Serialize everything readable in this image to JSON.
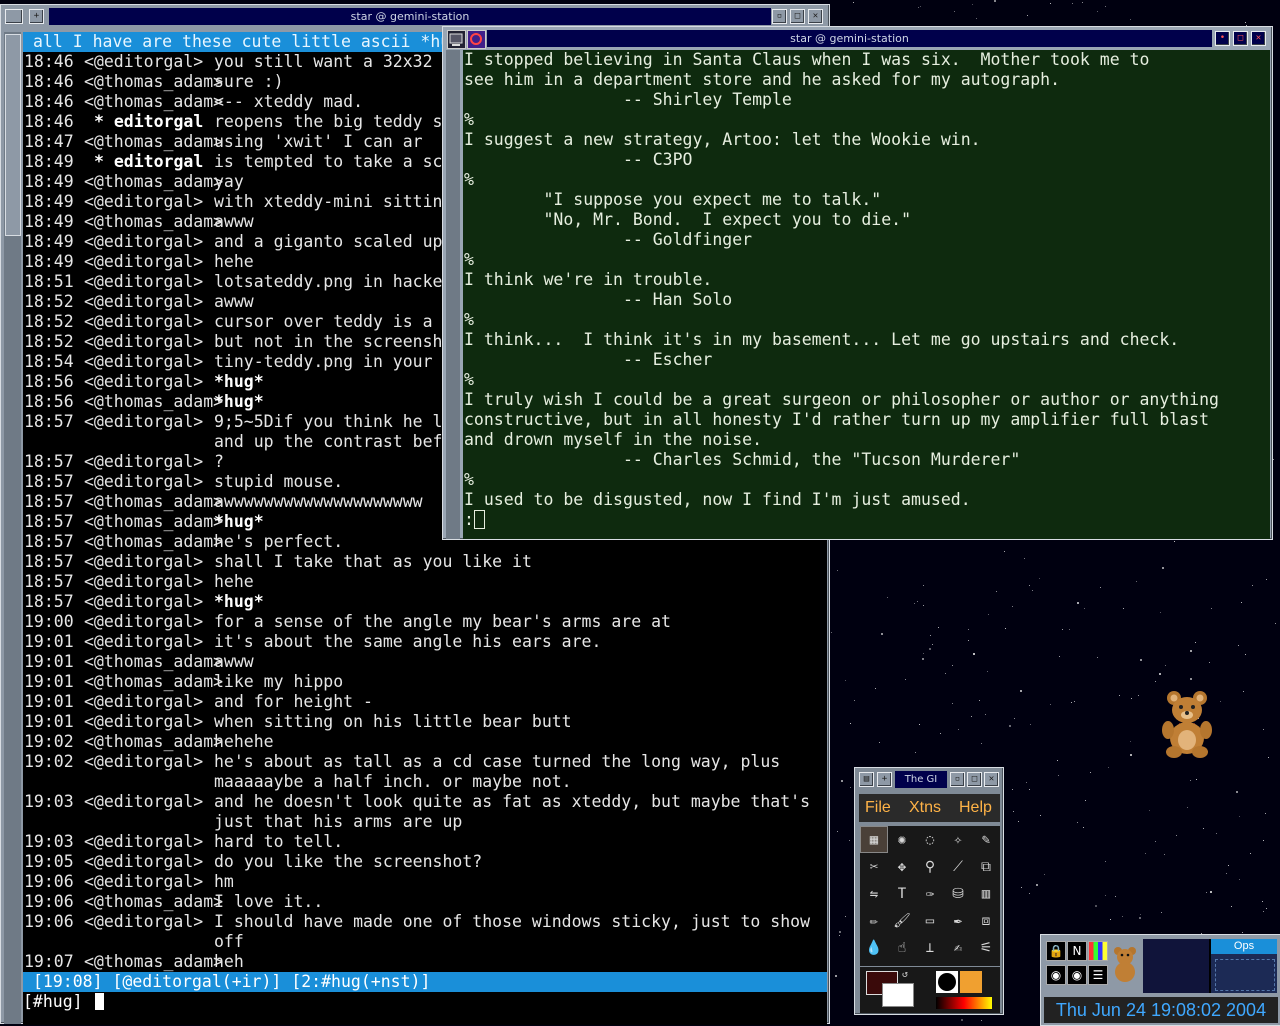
{
  "irc_window": {
    "title": "star @ gemini-station",
    "topic": "all I have are these cute little ascii *hugs*",
    "lines": [
      {
        "ts": "18:46",
        "nick": "<@editorgal>",
        "msg": "you still want a 32x32"
      },
      {
        "ts": "18:46",
        "nick": "<@thomas_adam>",
        "msg": "sure :)"
      },
      {
        "ts": "18:46",
        "nick": "<@thomas_adam>",
        "msg": "<-- xteddy mad."
      },
      {
        "ts": "18:46",
        "action": "* editorgal",
        "msg": "reopens the big teddy s"
      },
      {
        "ts": "18:47",
        "nick": "<@thomas_adam>",
        "msg": "using 'xwit' I can ar"
      },
      {
        "ts": "18:49",
        "action": "* editorgal",
        "msg": "is tempted to take a sc"
      },
      {
        "ts": "18:49",
        "nick": "<@thomas_adam>",
        "msg": "yay"
      },
      {
        "ts": "18:49",
        "nick": "<@editorgal>",
        "msg": "with xteddy-mini sittin"
      },
      {
        "ts": "18:49",
        "nick": "<@thomas_adam>",
        "msg": "awww"
      },
      {
        "ts": "18:49",
        "nick": "<@editorgal>",
        "msg": "and a giganto scaled up"
      },
      {
        "ts": "18:49",
        "nick": "<@editorgal>",
        "msg": "hehe"
      },
      {
        "ts": "18:51",
        "nick": "<@editorgal>",
        "msg": "lotsateddy.png in hacke"
      },
      {
        "ts": "18:52",
        "nick": "<@editorgal>",
        "msg": "awww"
      },
      {
        "ts": "18:52",
        "nick": "<@editorgal>",
        "msg": "cursor over teddy is a"
      },
      {
        "ts": "18:52",
        "nick": "<@editorgal>",
        "msg": "but not in the screensh"
      },
      {
        "ts": "18:54",
        "nick": "<@editorgal>",
        "msg": "tiny-teddy.png in your"
      },
      {
        "ts": "18:56",
        "nick": "<@editorgal>",
        "msg": "*hug*",
        "bold": true
      },
      {
        "ts": "18:56",
        "nick": "<@thomas_adam>",
        "msg": "*hug*",
        "bold": true
      },
      {
        "ts": "18:57",
        "nick": "<@editorgal>",
        "msg": "9;5~5Dif you think he l",
        "cont": "and up the contrast bef"
      },
      {
        "ts": "18:57",
        "nick": "<@editorgal>",
        "msg": "?"
      },
      {
        "ts": "18:57",
        "nick": "<@editorgal>",
        "msg": "stupid mouse."
      },
      {
        "ts": "18:57",
        "nick": "<@thomas_adam>",
        "msg": "awwwwwwwwwwwwwwwwwwww"
      },
      {
        "ts": "18:57",
        "nick": "<@thomas_adam>",
        "msg": "*hug*",
        "bold": true
      },
      {
        "ts": "18:57",
        "nick": "<@thomas_adam>",
        "msg": "he's perfect."
      },
      {
        "ts": "18:57",
        "nick": "<@editorgal>",
        "msg": "shall I take that as you like it"
      },
      {
        "ts": "18:57",
        "nick": "<@editorgal>",
        "msg": "hehe"
      },
      {
        "ts": "18:57",
        "nick": "<@editorgal>",
        "msg": "*hug*",
        "bold": true
      },
      {
        "ts": "19:00",
        "nick": "<@editorgal>",
        "msg": "for a sense of the angle my bear's arms are at"
      },
      {
        "ts": "19:01",
        "nick": "<@editorgal>",
        "msg": "it's about the same angle his ears are."
      },
      {
        "ts": "19:01",
        "nick": "<@thomas_adam>",
        "msg": "awww"
      },
      {
        "ts": "19:01",
        "nick": "<@thomas_adam>",
        "msg": "like my hippo"
      },
      {
        "ts": "19:01",
        "nick": "<@editorgal>",
        "msg": "and for height -"
      },
      {
        "ts": "19:01",
        "nick": "<@editorgal>",
        "msg": "when sitting on his little bear butt"
      },
      {
        "ts": "19:02",
        "nick": "<@thomas_adam>",
        "msg": "hehehe"
      },
      {
        "ts": "19:02",
        "nick": "<@editorgal>",
        "msg": "he's about as tall as a cd case turned the long way, plus",
        "cont": "maaaaaybe a half inch. or maybe not."
      },
      {
        "ts": "19:03",
        "nick": "<@editorgal>",
        "msg": "and he doesn't look quite as fat as xteddy, but maybe that's",
        "cont": "just that his arms are up"
      },
      {
        "ts": "19:03",
        "nick": "<@editorgal>",
        "msg": "hard to tell."
      },
      {
        "ts": "19:05",
        "nick": "<@editorgal>",
        "msg": "do you like the screenshot?"
      },
      {
        "ts": "19:06",
        "nick": "<@editorgal>",
        "msg": "hm"
      },
      {
        "ts": "19:06",
        "nick": "<@thomas_adam>",
        "msg": "I love it.."
      },
      {
        "ts": "19:06",
        "nick": "<@editorgal>",
        "msg": "I should have made one of those windows sticky, just to show",
        "cont": "off"
      },
      {
        "ts": "19:07",
        "nick": "<@thomas_adam>",
        "msg": "heh"
      }
    ],
    "status": {
      "time": "[19:08]",
      "nick": "[@editorgal(+ir)]",
      "channel": "[2:#hug(+nst)]"
    },
    "input_prompt": "[#hug]"
  },
  "fortune_window": {
    "title": "star @ gemini-station",
    "lines": [
      "I stopped believing in Santa Claus when I was six.  Mother took me to",
      "see him in a department store and he asked for my autograph.",
      "                -- Shirley Temple",
      "%",
      "I suggest a new strategy, Artoo: let the Wookie win.",
      "                -- C3PO",
      "%",
      "        \"I suppose you expect me to talk.\"",
      "        \"No, Mr. Bond.  I expect you to die.\"",
      "                -- Goldfinger",
      "%",
      "I think we're in trouble.",
      "                -- Han Solo",
      "%",
      "I think...  I think it's in my basement... Let me go upstairs and check.",
      "                -- Escher",
      "%",
      "I truly wish I could be a great surgeon or philosopher or author or anything",
      "constructive, but in all honesty I'd rather turn up my amplifier full blast",
      "and drown myself in the noise.",
      "                -- Charles Schmid, the \"Tucson Murderer\"",
      "%",
      "I used to be disgusted, now I find I'm just amused."
    ],
    "prompt": ":"
  },
  "gimp_toolbox": {
    "title": "The GI",
    "menu": {
      "file": "File",
      "xtns": "Xtns",
      "help": "Help"
    }
  },
  "pager": {
    "clock": "Thu Jun 24 19:08:02 2004",
    "desk_label": "Ops",
    "buttons": {
      "n": "N"
    }
  },
  "colors": {
    "accent": "#1a8fd9",
    "title_bg": "#00004b",
    "frame": "#8e99a6",
    "fortune_bg": "#0e2a0e"
  }
}
